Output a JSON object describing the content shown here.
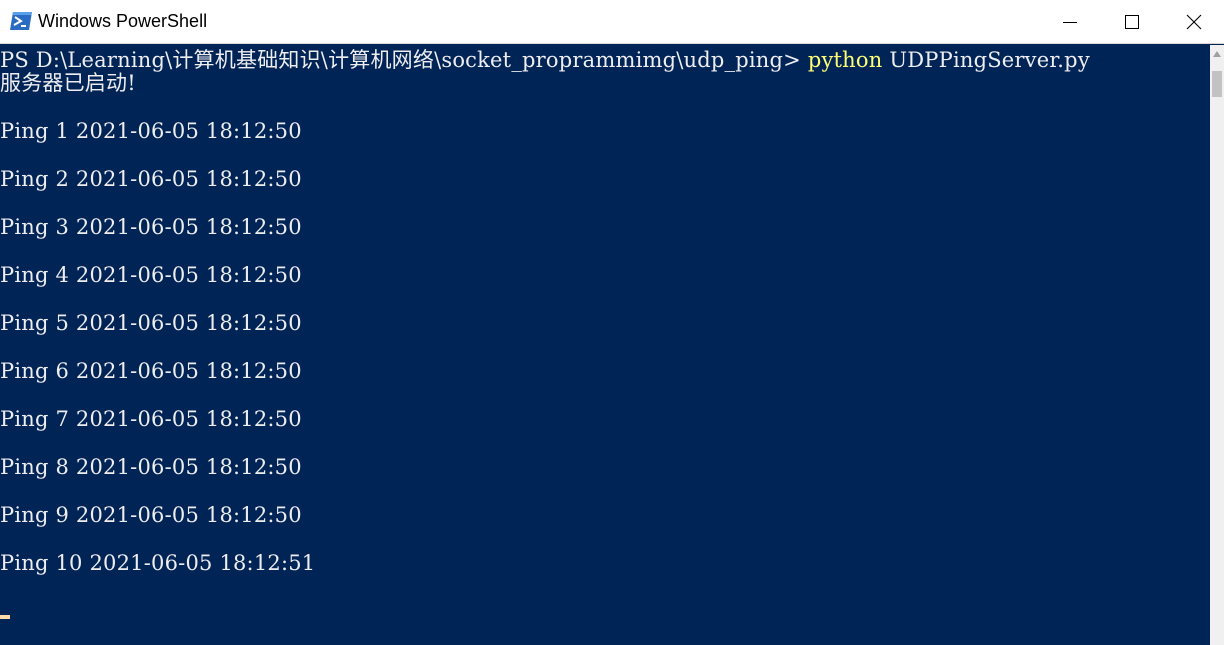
{
  "window": {
    "title": "Windows PowerShell",
    "icon": "powershell-icon"
  },
  "controls": {
    "minimize": "minimize-icon",
    "maximize": "maximize-icon",
    "close": "close-icon"
  },
  "console": {
    "prompt": "PS D:\\Learning\\计算机基础知识\\计算机网络\\socket_proprammimg\\udp_ping> ",
    "command": "python",
    "command_args": " UDPPingServer.py",
    "started": "服务器已启动!",
    "pings": [
      "Ping 1 2021-06-05 18:12:50",
      "Ping 2 2021-06-05 18:12:50",
      "Ping 3 2021-06-05 18:12:50",
      "Ping 4 2021-06-05 18:12:50",
      "Ping 5 2021-06-05 18:12:50",
      "Ping 6 2021-06-05 18:12:50",
      "Ping 7 2021-06-05 18:12:50",
      "Ping 8 2021-06-05 18:12:50",
      "Ping 9 2021-06-05 18:12:50",
      "Ping 10 2021-06-05 18:12:51"
    ]
  },
  "colors": {
    "background": "#012456",
    "text": "#eeedf0",
    "command_highlight": "#ffff76",
    "cursor": "#fedba9"
  }
}
